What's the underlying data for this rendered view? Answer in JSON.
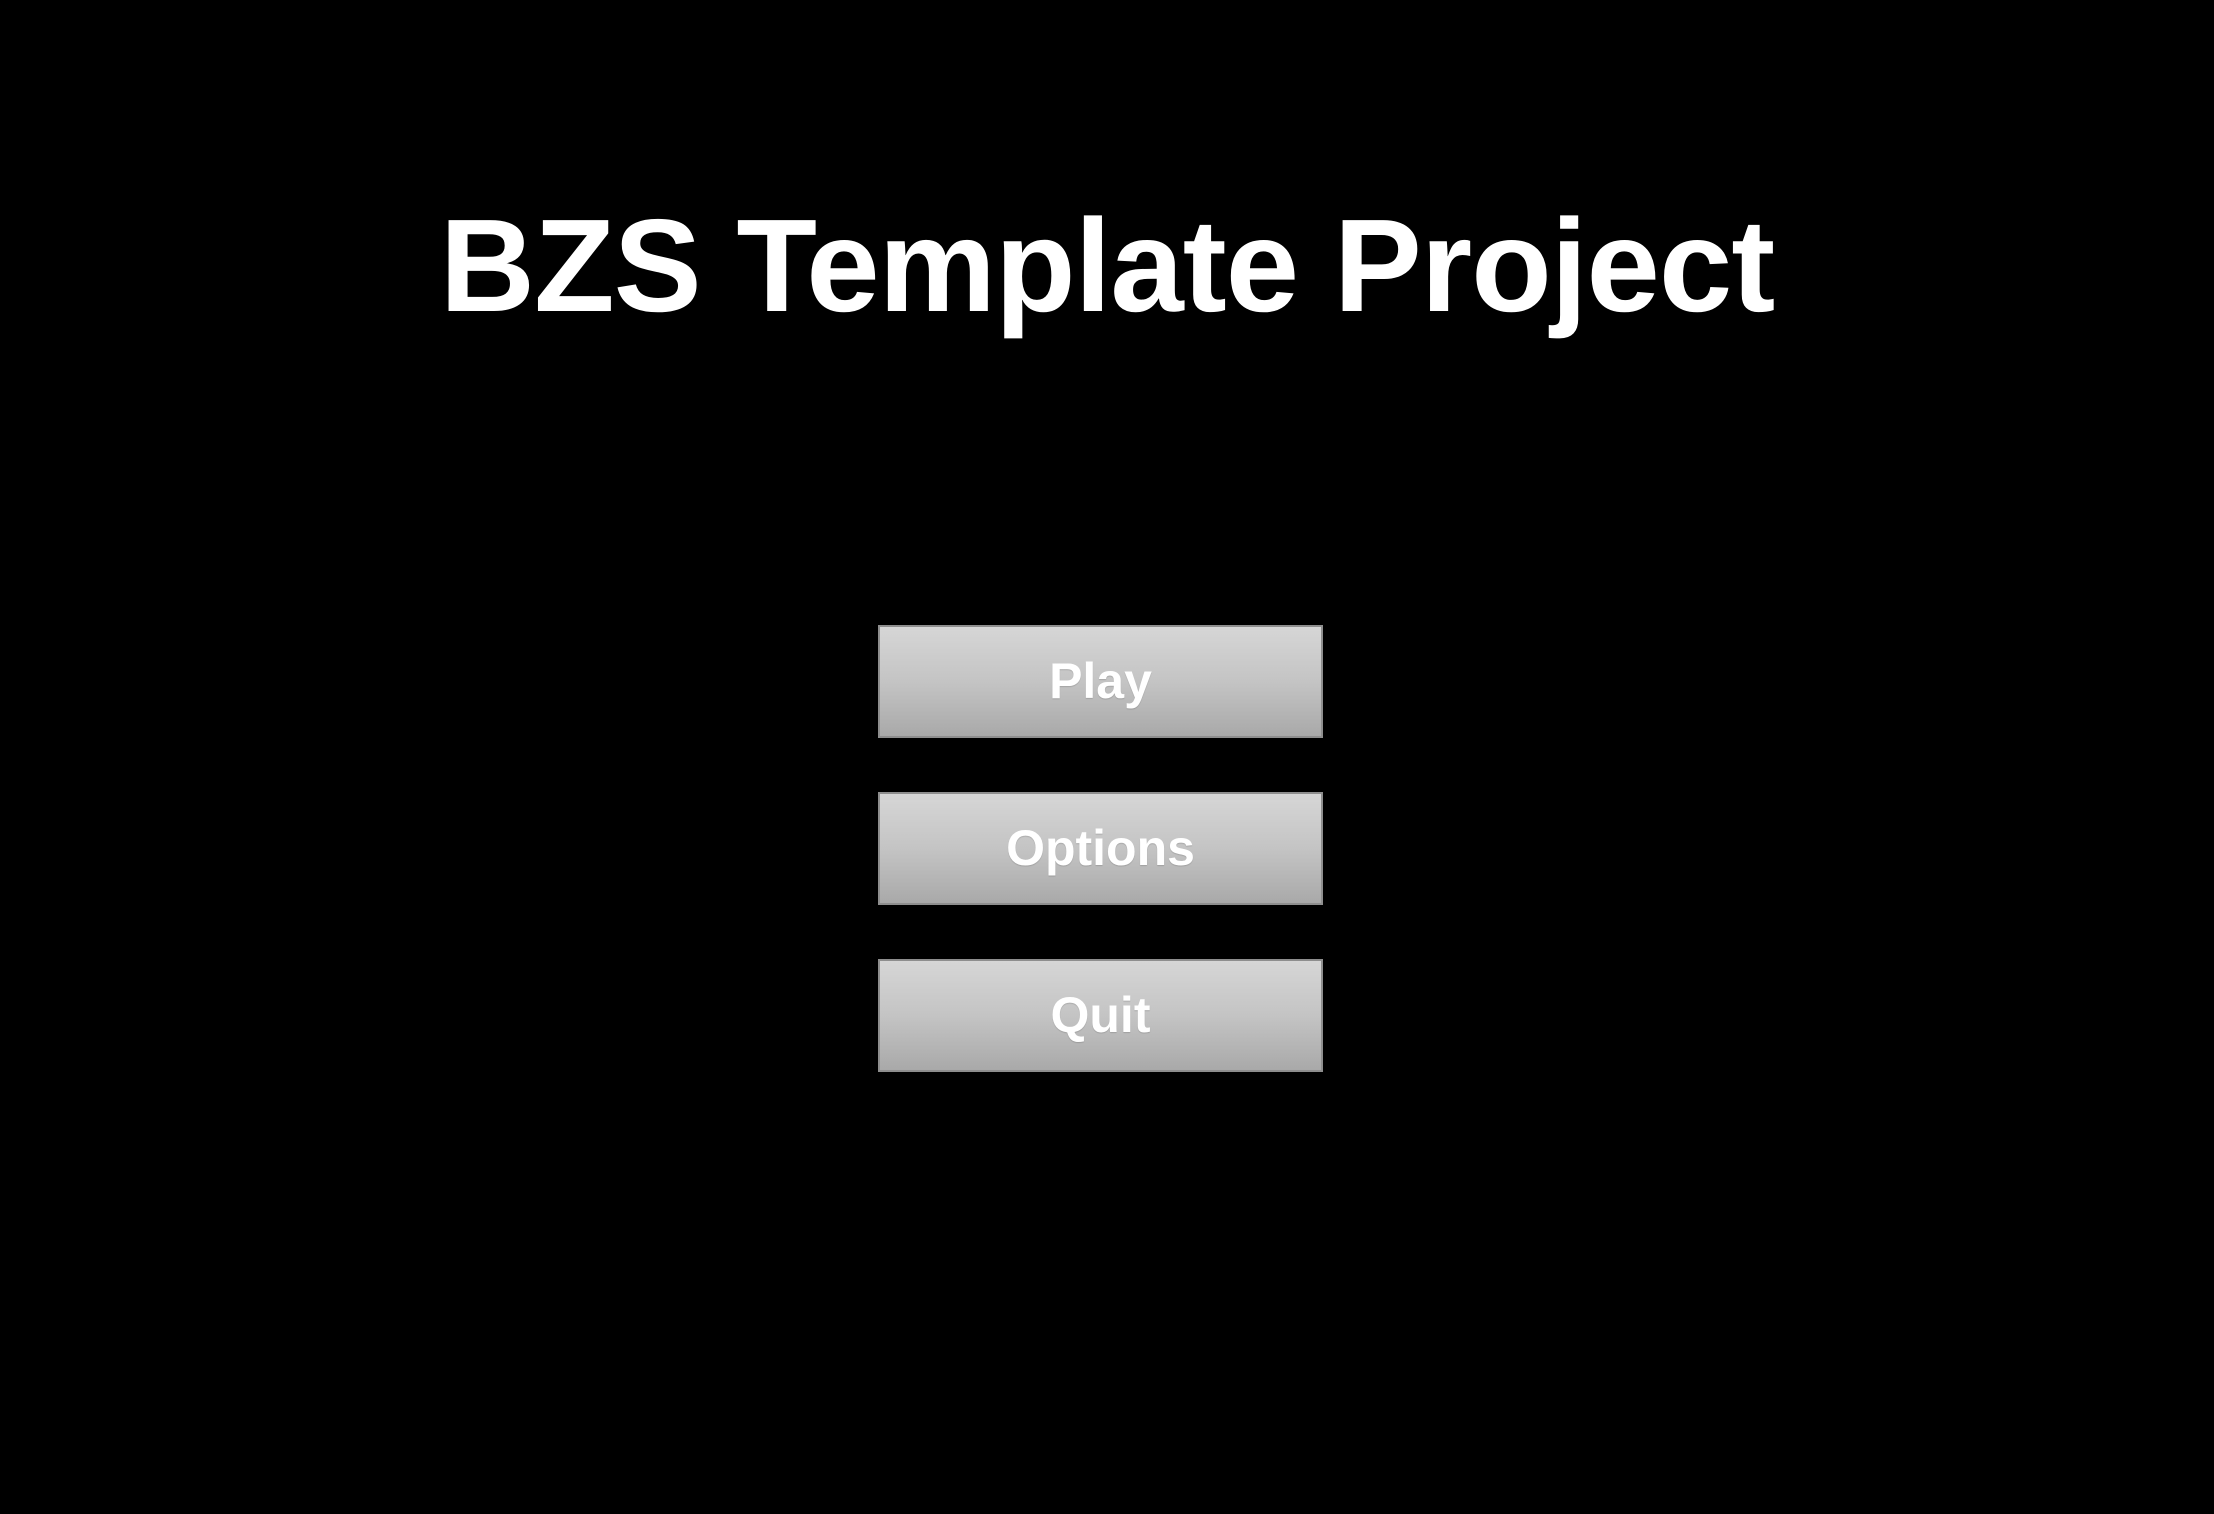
{
  "title": "BZS Template Project",
  "menu": {
    "buttons": [
      {
        "label": "Play"
      },
      {
        "label": "Options"
      },
      {
        "label": "Quit"
      }
    ]
  },
  "colors": {
    "background": "#000000",
    "title_text": "#ffffff",
    "button_text": "#ffffff",
    "button_top": "#d6d6d6",
    "button_bottom": "#a9a9a9"
  }
}
